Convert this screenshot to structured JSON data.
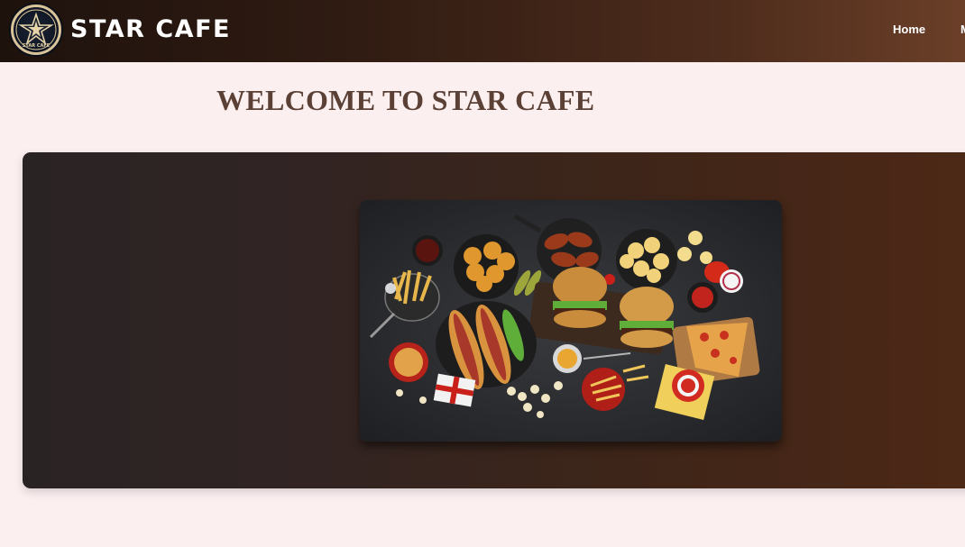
{
  "navbar": {
    "brand": "STAR CAFE",
    "logo_text": "STAR CAFE",
    "links": [
      {
        "label": "Home"
      },
      {
        "label": "M"
      }
    ]
  },
  "main": {
    "welcome_title": "WELCOME TO STAR CAFE"
  },
  "hero": {
    "image_icon": "food-spread-image"
  },
  "colors": {
    "page_bg": "#fbeff0",
    "nav_dark": "#1e120d",
    "nav_light": "#6b3f28",
    "title_color": "#5b4036"
  }
}
